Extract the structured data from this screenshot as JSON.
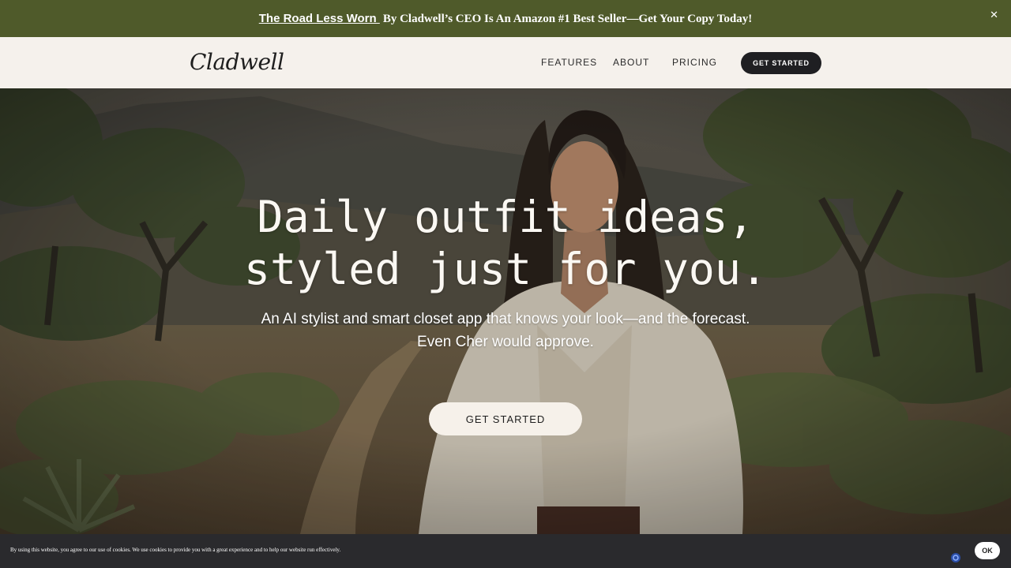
{
  "announcement": {
    "link_text": "The Road Less Worn ",
    "text": "By Cladwell’s CEO Is An Amazon #1 Best Seller—Get Your Copy Today!",
    "close_label": "✕",
    "background": "#4f5a2a"
  },
  "header": {
    "logo": "Cladwell",
    "nav": {
      "features": "FEATURES",
      "about": "ABOUT",
      "pricing": "PRICING"
    },
    "cta_label": "GET STARTED"
  },
  "hero": {
    "headline_line1": "Daily outfit ideas,",
    "headline_line2": "styled just for you.",
    "sub_line1": "An AI stylist and smart closet app that knows your look—and the forecast.",
    "sub_line2": "Even Cher would approve.",
    "cta_label": "GET STARTED"
  },
  "cookie": {
    "text": "By using this website, you agree to our use of cookies. We use cookies to provide you with a great experience and to help our website run effectively.",
    "ok_label": "OK"
  },
  "colors": {
    "accent_dark": "#1f1f22",
    "cream": "#f5f1ec",
    "announcement_green": "#4f5a2a"
  }
}
